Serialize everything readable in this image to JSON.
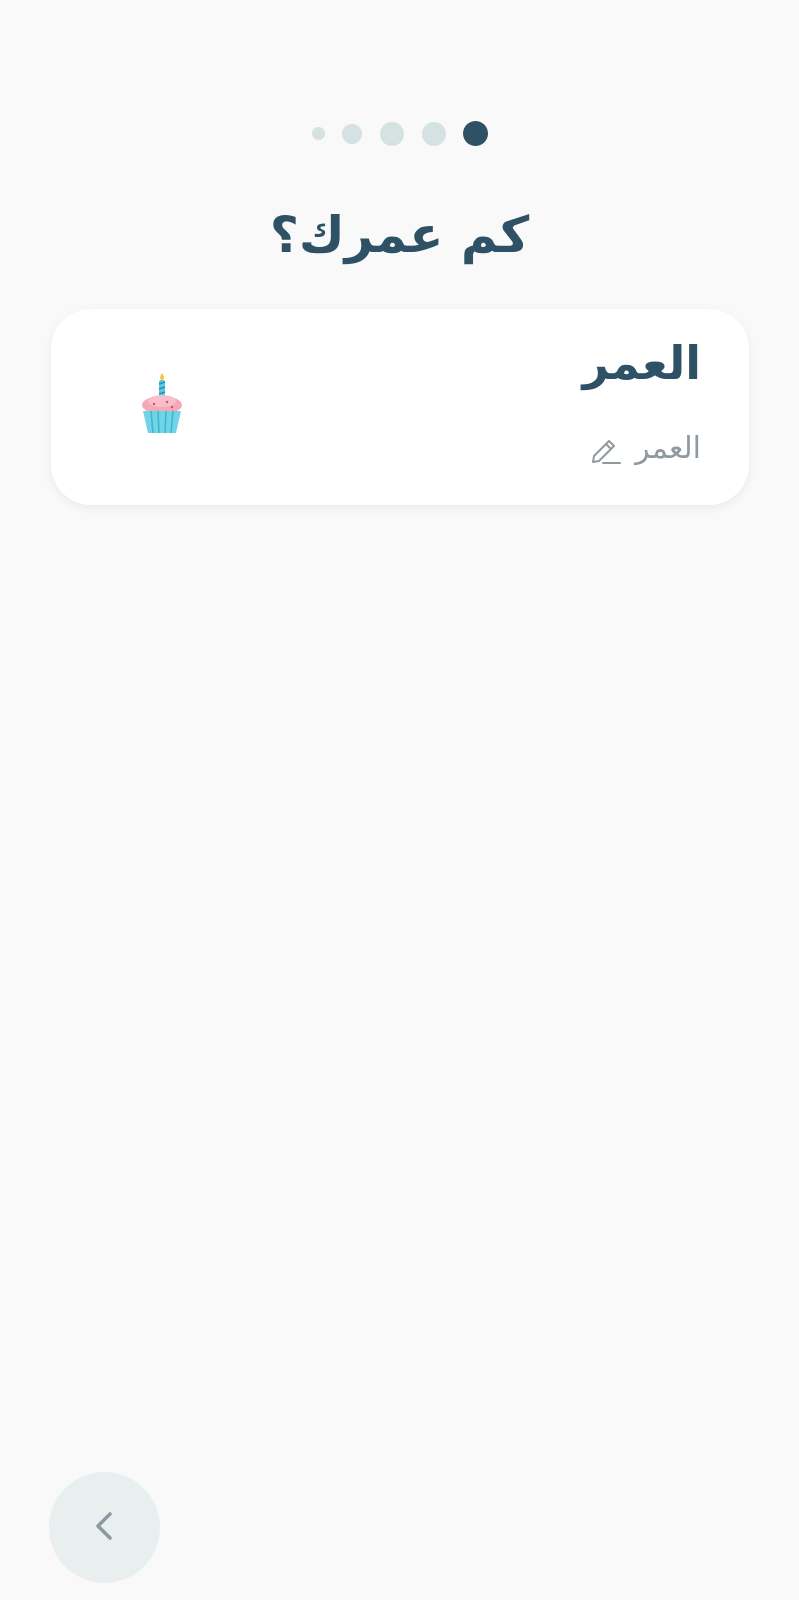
{
  "progress": {
    "total_steps": 5,
    "current_step": 5,
    "active_color": "#2e5166",
    "inactive_color": "#d4e2e2"
  },
  "header": {
    "title": "كم عمرك؟"
  },
  "age_card": {
    "label": "العمر",
    "input_placeholder": "العمر",
    "input_value": "",
    "edit_icon": "pencil-icon",
    "decoration_icon": "cupcake-icon"
  },
  "navigation": {
    "back_icon": "chevron-left-icon"
  },
  "colors": {
    "background": "#f9f9f9",
    "primary_text": "#2e5166",
    "placeholder_text": "#8f9aa0",
    "back_button_bg": "#e9eeef"
  }
}
